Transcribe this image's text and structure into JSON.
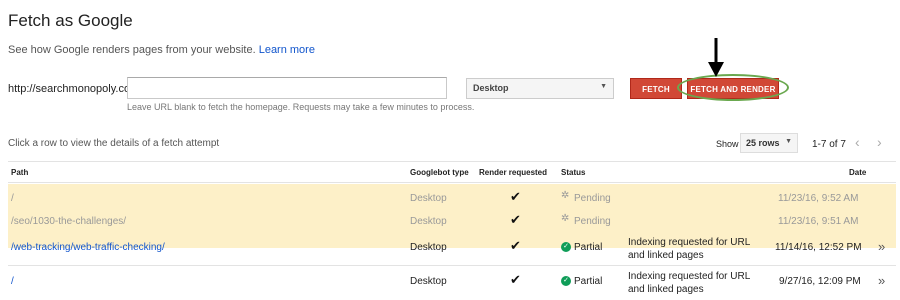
{
  "header": {
    "title": "Fetch as Google",
    "subtitle": "See how Google renders pages from your website.",
    "learn_more": "Learn more"
  },
  "fetch_form": {
    "url_prefix": "http://searchmonopoly.com/",
    "url_value": "",
    "hint": "Leave URL blank to fetch the homepage. Requests may take a few minutes to process.",
    "device": "Desktop",
    "fetch_label": "FETCH",
    "fetch_render_label": "FETCH AND RENDER"
  },
  "table_controls": {
    "row_hint": "Click a row to view the details of a fetch attempt",
    "show_label": "Show",
    "rows_value": "25 rows",
    "range": "1-7 of 7"
  },
  "columns": {
    "path": "Path",
    "googlebot_type": "Googlebot type",
    "render_requested": "Render requested",
    "status": "Status",
    "date": "Date"
  },
  "rows": [
    {
      "path": "/",
      "type": "Desktop",
      "render": "✔",
      "status": "Pending",
      "detail": "",
      "date": "11/23/16, 9:52 AM"
    },
    {
      "path": "/seo/1030-the-challenges/",
      "type": "Desktop",
      "render": "✔",
      "status": "Pending",
      "detail": "",
      "date": "11/23/16, 9:51 AM"
    },
    {
      "path": "/web-tracking/web-traffic-checking/",
      "type": "Desktop",
      "render": "✔",
      "status": "Partial",
      "detail": "Indexing requested for URL and linked pages",
      "date": "11/14/16, 12:52 PM"
    },
    {
      "path": "/",
      "type": "Desktop",
      "render": "✔",
      "status": "Partial",
      "detail": "Indexing requested for URL and linked pages",
      "date": "9/27/16, 12:09 PM"
    }
  ],
  "colors": {
    "accent_red": "#d14836",
    "pending_row": "#fdf0c8",
    "link_blue": "#1155cc",
    "ok_green": "#0f9d58",
    "annotation_green": "#6aa84f"
  }
}
